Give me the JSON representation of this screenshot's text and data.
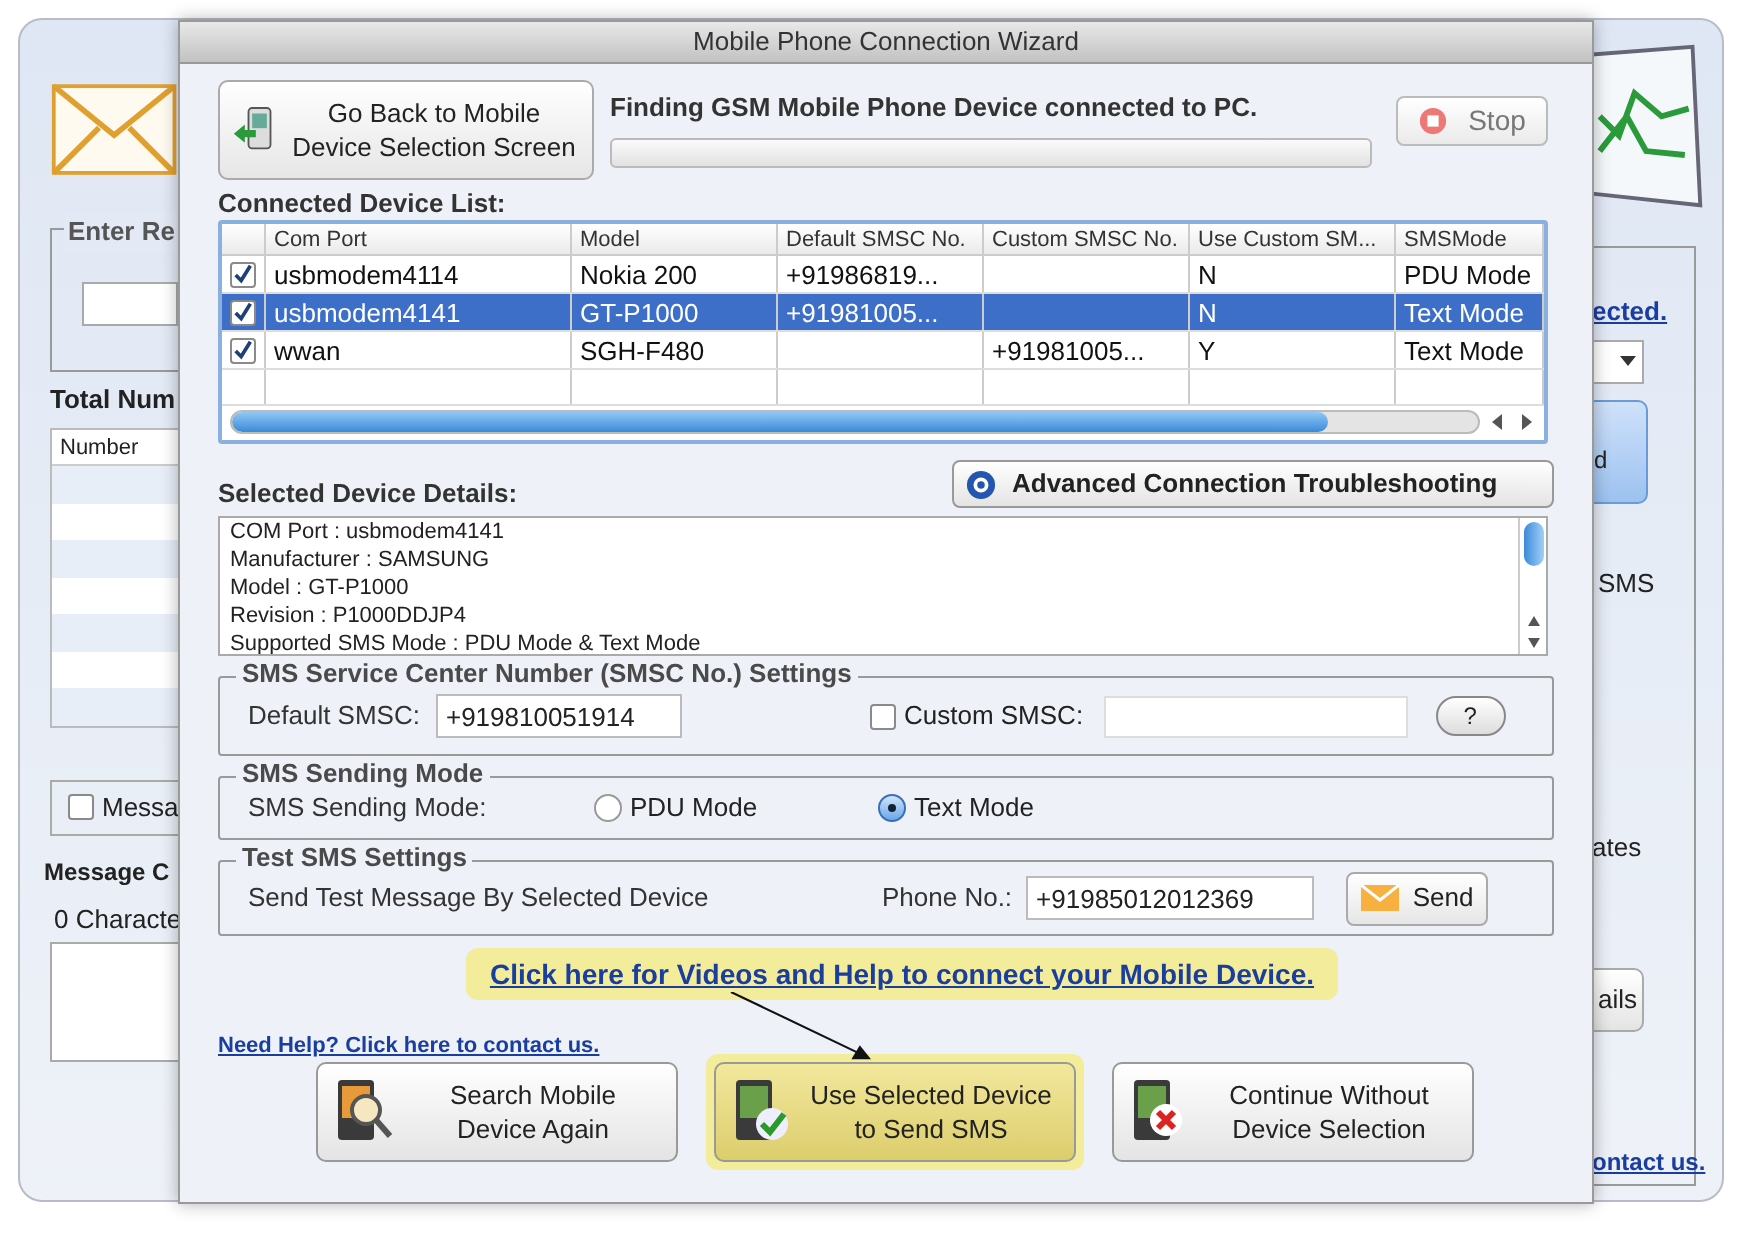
{
  "background_window": {
    "left": {
      "recipient_group_title": "Enter Re",
      "total_label": "Total Num",
      "number_column": "Number",
      "message_checkbox": {
        "label": "Messa",
        "checked": false
      },
      "message_label": "Message C",
      "char_count": "0 Characte"
    },
    "right": {
      "link": "ected.",
      "side_button": "d",
      "sms_label": "SMS",
      "templates_label": "ates",
      "details_button": "ails",
      "contact_link": "ontact us."
    }
  },
  "dialog": {
    "title": "Mobile Phone Connection Wizard",
    "back_button": "Go Back to Mobile\nDevice Selection Screen",
    "status": "Finding GSM Mobile Phone Device connected to PC.",
    "progress": {
      "level": 0
    },
    "stop_button": "Stop",
    "device_list": {
      "title": "Connected Device List:",
      "columns": [
        "Com Port",
        "Model",
        "Default SMSC No.",
        "Custom SMSC No.",
        "Use Custom SM...",
        "SMSMode"
      ],
      "rows": [
        {
          "checked": true,
          "selected": false,
          "cells": [
            "usbmodem4114",
            "Nokia 200",
            "+91986819...",
            "",
            "N",
            "PDU Mode"
          ]
        },
        {
          "checked": true,
          "selected": true,
          "cells": [
            "usbmodem4141",
            "GT-P1000",
            "+91981005...",
            "",
            "N",
            "Text Mode"
          ]
        },
        {
          "checked": true,
          "selected": false,
          "cells": [
            "wwan",
            "SGH-F480",
            "",
            "+91981005...",
            "Y",
            "Text Mode"
          ]
        }
      ]
    },
    "troubleshoot_button": "Advanced Connection Troubleshooting",
    "details": {
      "title": "Selected Device Details:",
      "lines": [
        "COM Port : usbmodem4141",
        "Manufacturer : SAMSUNG",
        "Model : GT-P1000",
        "Revision : P1000DDJP4",
        "Supported SMS Mode : PDU Mode & Text Mode"
      ]
    },
    "smsc_settings": {
      "title": "SMS Service Center Number (SMSC No.) Settings",
      "default_label": "Default SMSC:",
      "default_value": "+919810051914",
      "custom_checkbox": {
        "label": "Custom SMSC:",
        "checked": false
      },
      "help_button": "?"
    },
    "sending_mode": {
      "title": "SMS Sending Mode",
      "label": "SMS Sending Mode:",
      "options": [
        {
          "label": "PDU Mode",
          "selected": false
        },
        {
          "label": "Text Mode",
          "selected": true
        }
      ]
    },
    "test_sms": {
      "title": "Test SMS Settings",
      "label": "Send Test Message By Selected Device",
      "phone_label": "Phone No.:",
      "phone_value": "+91985012012369",
      "send_button": "Send"
    },
    "video_help_link": "Click here for Videos and Help to connect your Mobile Device.",
    "contact_link": "Need Help? Click here to contact us.",
    "buttons": [
      {
        "kind": "search",
        "label": "Search Mobile\nDevice Again",
        "highlighted": false
      },
      {
        "kind": "use",
        "label": "Use Selected Device\nto Send SMS",
        "highlighted": true
      },
      {
        "kind": "skip",
        "label": "Continue Without\nDevice Selection",
        "highlighted": false
      }
    ]
  }
}
